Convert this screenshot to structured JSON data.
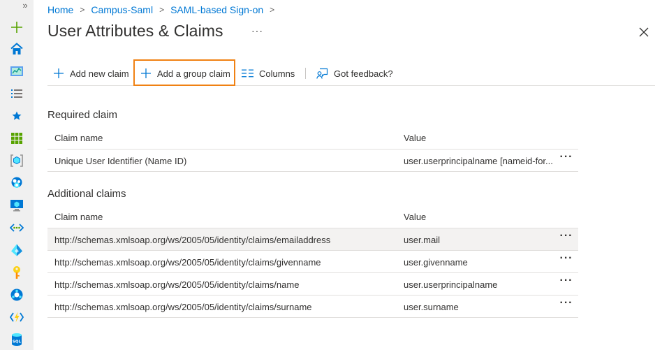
{
  "breadcrumb": {
    "items": [
      "Home",
      "Campus-Saml",
      "SAML-based Sign-on"
    ],
    "separator": ">"
  },
  "page": {
    "title": "User Attributes & Claims",
    "more": "···"
  },
  "rail": {
    "expand": "»",
    "icons": [
      "create-resource-icon",
      "home-icon",
      "dashboard-icon",
      "all-services-icon",
      "favorites-star-icon",
      "all-resources-icon",
      "resource-groups-icon",
      "app-services-icon",
      "virtual-machines-icon",
      "virtual-networks-icon",
      "azure-ad-icon",
      "key-vault-icon",
      "monitor-icon",
      "functions-icon",
      "sql-database-icon"
    ]
  },
  "toolbar": {
    "add_new_claim": "Add new claim",
    "add_group_claim": "Add a group claim",
    "columns": "Columns",
    "feedback": "Got feedback?"
  },
  "required": {
    "title": "Required claim",
    "columns": [
      "Claim name",
      "Value"
    ],
    "rows": [
      {
        "name": "Unique User Identifier (Name ID)",
        "value": "user.userprincipalname [nameid-for..."
      }
    ]
  },
  "additional": {
    "title": "Additional claims",
    "columns": [
      "Claim name",
      "Value"
    ],
    "rows": [
      {
        "name": "http://schemas.xmlsoap.org/ws/2005/05/identity/claims/emailaddress",
        "value": "user.mail"
      },
      {
        "name": "http://schemas.xmlsoap.org/ws/2005/05/identity/claims/givenname",
        "value": "user.givenname"
      },
      {
        "name": "http://schemas.xmlsoap.org/ws/2005/05/identity/claims/name",
        "value": "user.userprincipalname"
      },
      {
        "name": "http://schemas.xmlsoap.org/ws/2005/05/identity/claims/surname",
        "value": "user.surname"
      }
    ]
  },
  "row_more": "···",
  "colors": {
    "accent": "#0078d4",
    "highlight": "#f08113"
  }
}
